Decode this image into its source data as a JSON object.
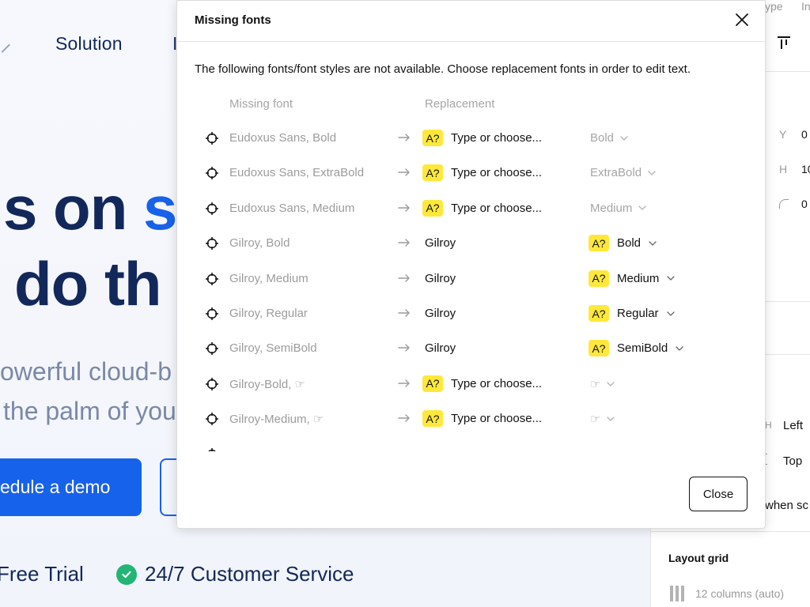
{
  "canvas": {
    "nav_solution": "Solution",
    "nav_next": "I",
    "hero_line1_dark": "s on ",
    "hero_line1_blue": "s",
    "hero_line2": "do th",
    "sub_line1": "owerful cloud-b",
    "sub_line2": "the palm of you",
    "cta_label": "edule a demo",
    "feature1": "Free Trial",
    "feature2": "24/7 Customer Service",
    "colors": {
      "navy": "#13285a",
      "blue": "#1762ea",
      "green": "#22b573"
    }
  },
  "panel": {
    "tab_type": "ype",
    "tab_in": "In",
    "y_label": "Y",
    "y_value": "0",
    "h_label": "H",
    "h_value": "10",
    "radius_value": "0",
    "h_frag": "H",
    "constraint_left": "Left",
    "constraint_top": "Top",
    "scroll_label": "when sc",
    "layout_grid_title": "Layout grid",
    "layout_grid_value": "12 columns (auto)"
  },
  "modal": {
    "title": "Missing fonts",
    "description": "The following fonts/font styles are not available. Choose replacement fonts in order to edit text.",
    "col_missing": "Missing font",
    "col_replacement": "Replacement",
    "close_button": "Close",
    "badge_text": "A?",
    "rows": [
      {
        "missing": "Eudoxus Sans, Bold",
        "replacement": "Type or choose...",
        "replacement_missing": true,
        "style": "Bold",
        "style_missing": false
      },
      {
        "missing": "Eudoxus Sans, ExtraBold",
        "replacement": "Type or choose...",
        "replacement_missing": true,
        "style": "ExtraBold",
        "style_missing": false
      },
      {
        "missing": "Eudoxus Sans, Medium",
        "replacement": "Type or choose...",
        "replacement_missing": true,
        "style": "Medium",
        "style_missing": false
      },
      {
        "missing": "Gilroy, Bold",
        "replacement": "Gilroy",
        "replacement_missing": false,
        "style": "Bold",
        "style_missing": true
      },
      {
        "missing": "Gilroy, Medium",
        "replacement": "Gilroy",
        "replacement_missing": false,
        "style": "Medium",
        "style_missing": true
      },
      {
        "missing": "Gilroy, Regular",
        "replacement": "Gilroy",
        "replacement_missing": false,
        "style": "Regular",
        "style_missing": true
      },
      {
        "missing": "Gilroy, SemiBold",
        "replacement": "Gilroy",
        "replacement_missing": false,
        "style": "SemiBold",
        "style_missing": true
      },
      {
        "missing": "Gilroy-Bold, ☞",
        "replacement": "Type or choose...",
        "replacement_missing": true,
        "style": "☞",
        "style_missing": false
      },
      {
        "missing": "Gilroy-Medium, ☞",
        "replacement": "Type or choose...",
        "replacement_missing": true,
        "style": "☞",
        "style_missing": false
      }
    ],
    "badge_color": "#ffe83a"
  }
}
